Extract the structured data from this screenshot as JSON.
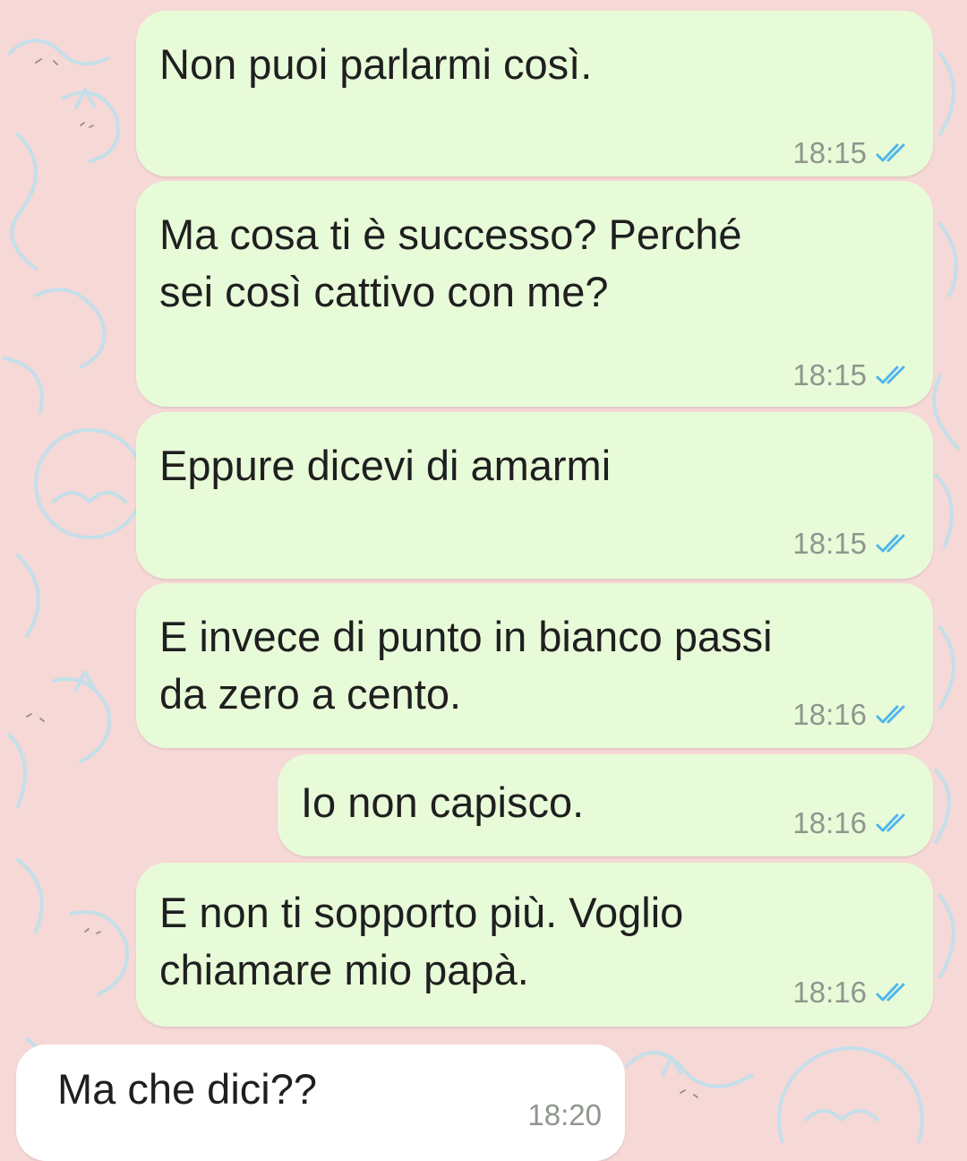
{
  "chat": {
    "background": "#f6d8d6",
    "outgoing_bubble_color": "#e8fbd9",
    "incoming_bubble_color": "#ffffff",
    "read_tick_color": "#4fb6ec",
    "read_receipt_icon": "double-check-icon",
    "messages": [
      {
        "text": "Non puoi parlarmi così.",
        "time": "18:15",
        "status": "read"
      },
      {
        "text": "Ma cosa ti è successo? Perché\nsei così cattivo con me?",
        "time": "18:15",
        "status": "read"
      },
      {
        "text": "Eppure dicevi di amarmi",
        "time": "18:15",
        "status": "read"
      },
      {
        "text": "E invece di punto in bianco passi\nda zero a cento.",
        "time": "18:16",
        "status": "read"
      },
      {
        "text": "Io non capisco.",
        "time": "18:16",
        "status": "read"
      },
      {
        "text": "E non ti sopporto più. Voglio\nchiamare mio papà.",
        "time": "18:16",
        "status": "read"
      },
      {
        "text": "Ma che dici??",
        "time": "18:20",
        "direction": "incoming"
      }
    ]
  }
}
